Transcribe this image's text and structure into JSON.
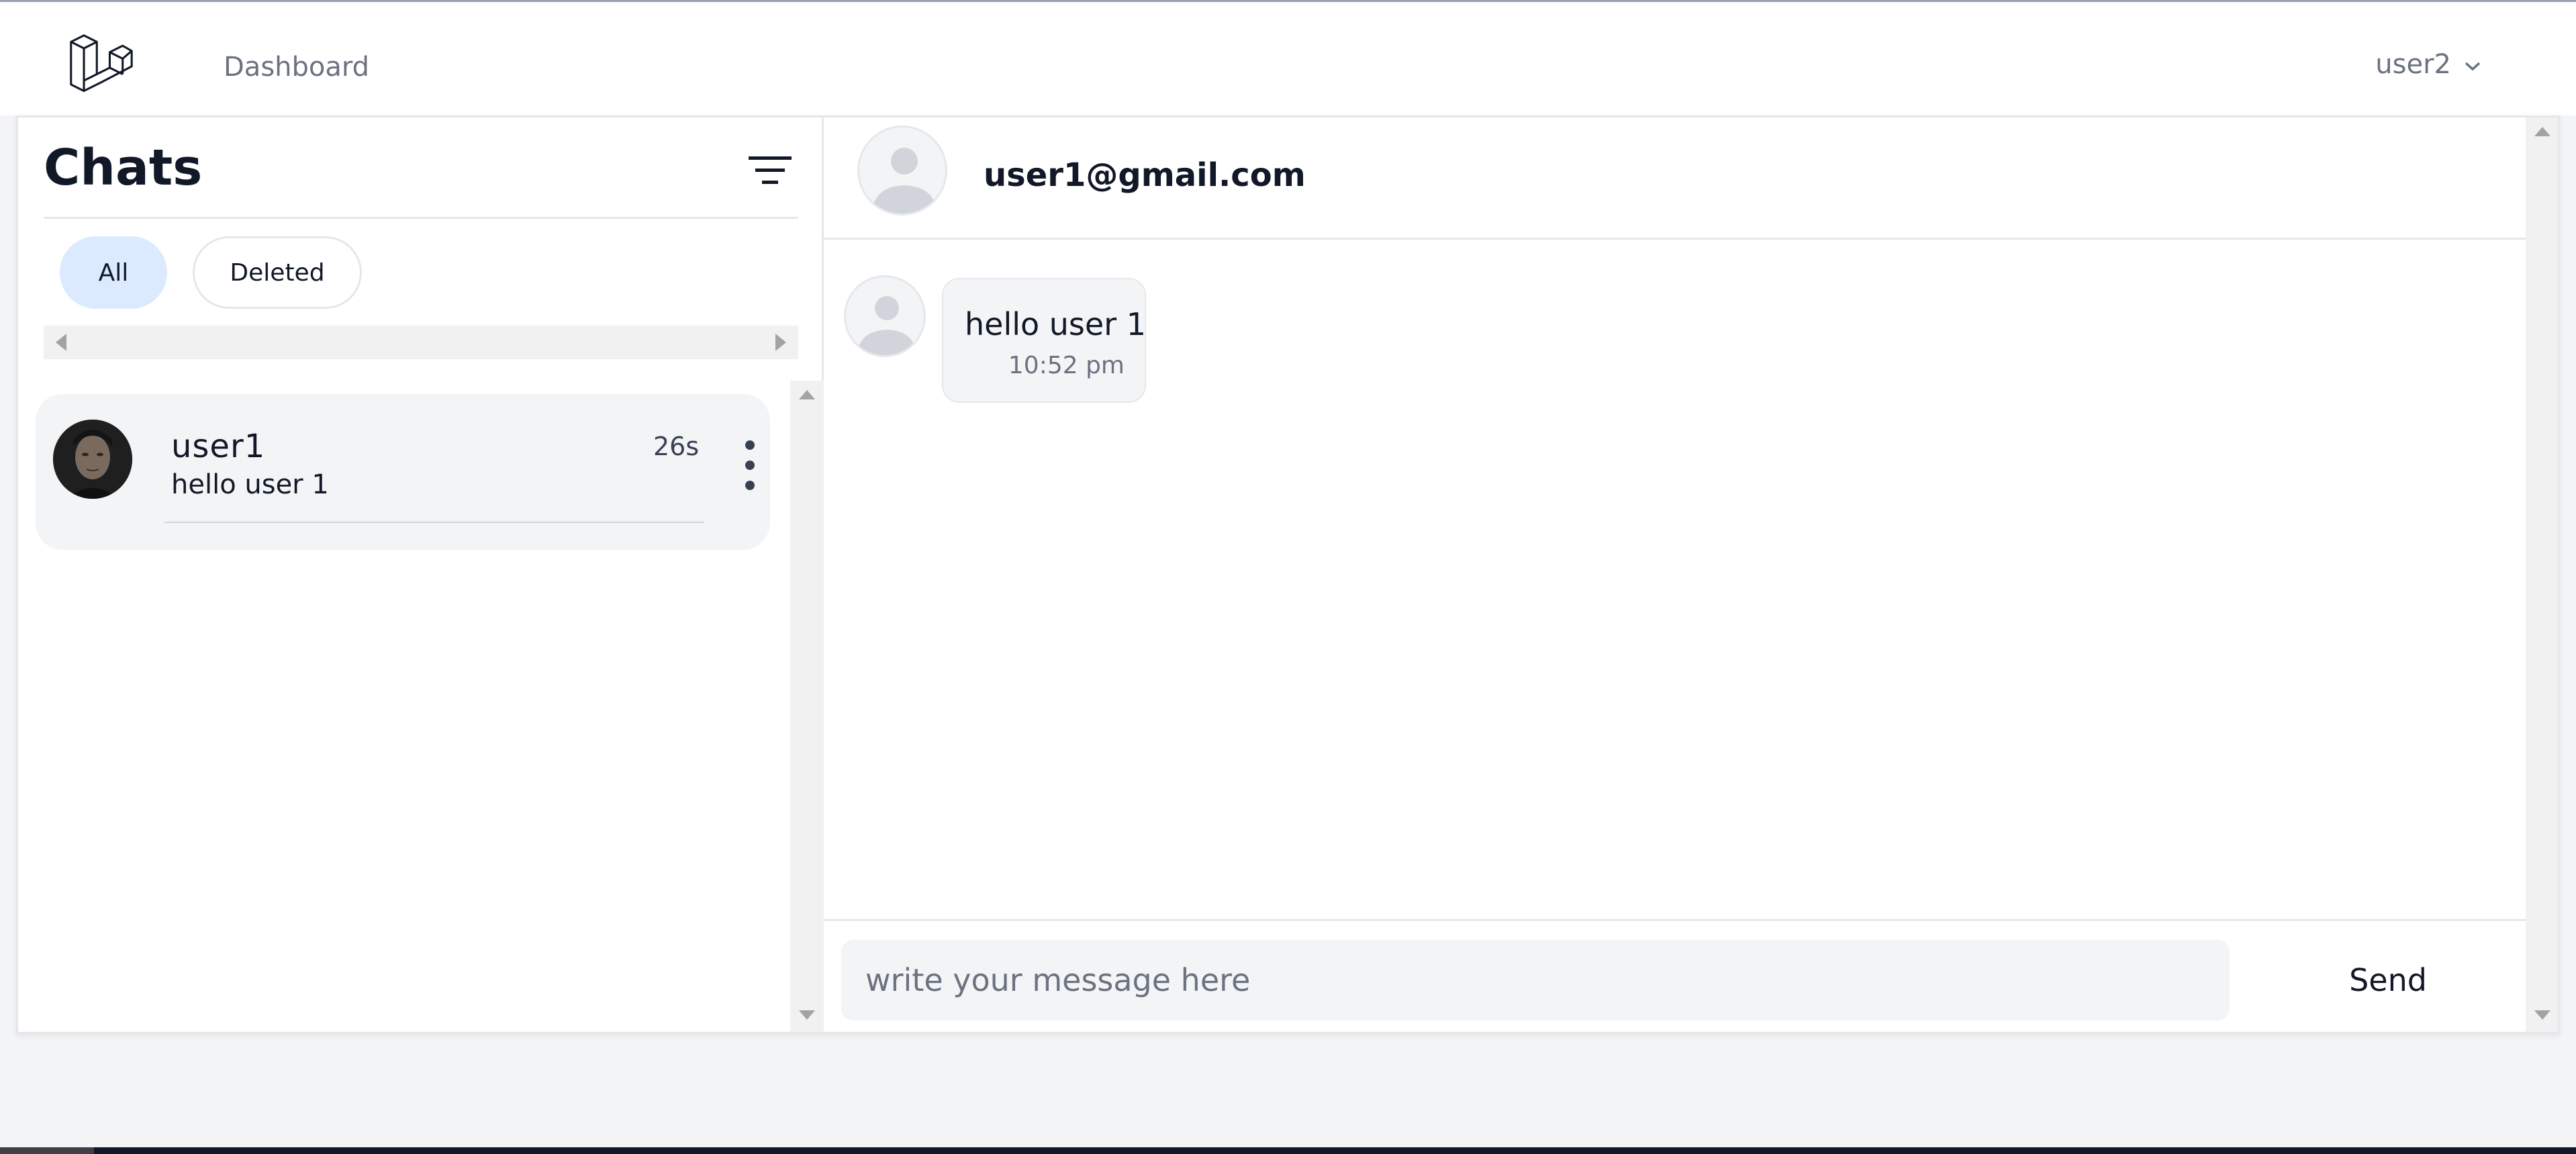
{
  "nav": {
    "logo_icon": "laravel-logo-icon",
    "dashboard_label": "Dashboard",
    "user_label": "user2",
    "user_dropdown_icon": "chevron-down-icon"
  },
  "sidebar": {
    "title": "Chats",
    "filter_icon": "filter-icon",
    "filters": [
      {
        "label": "All",
        "active": true
      },
      {
        "label": "Deleted",
        "active": false
      }
    ],
    "chats": [
      {
        "name": "user1",
        "last_message": "hello user 1",
        "time": "26s",
        "menu_icon": "more-vertical-icon"
      }
    ]
  },
  "conversation": {
    "contact_email": "user1@gmail.com",
    "messages": [
      {
        "text": "hello user 1",
        "time": "10:52 pm"
      }
    ],
    "composer": {
      "placeholder": "write your message here",
      "value": "",
      "send_label": "Send"
    }
  },
  "colors": {
    "active_filter_bg": "#dbeafe",
    "page_bg": "#f3f4f6",
    "bubble_bg": "#f3f4f6"
  }
}
